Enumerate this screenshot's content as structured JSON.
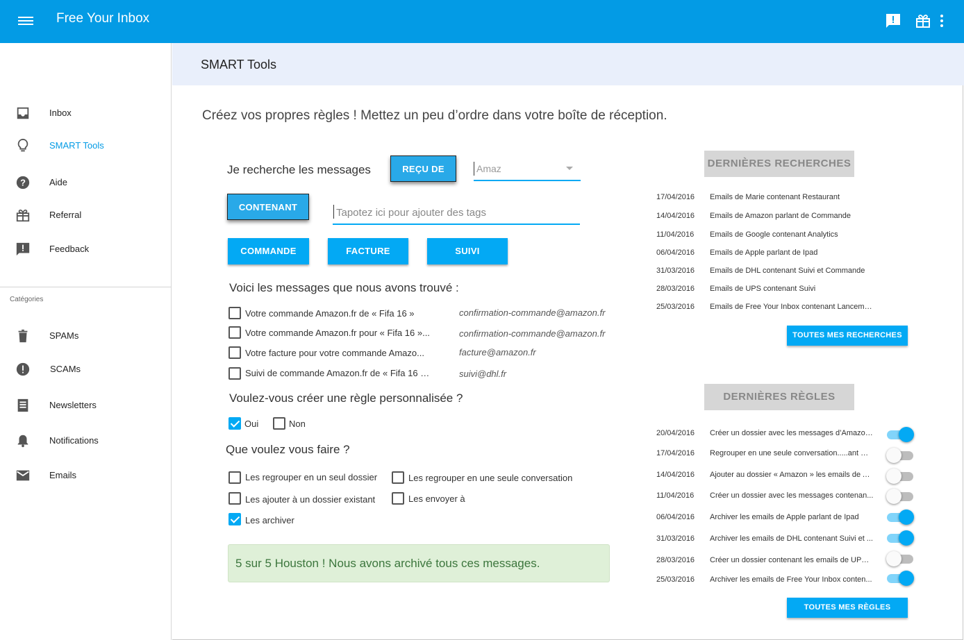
{
  "app": {
    "title": "Free Your Inbox"
  },
  "header": {
    "title": "SMART Tools"
  },
  "sidebar": {
    "items": [
      {
        "label": "Inbox",
        "icon": "inbox-icon"
      },
      {
        "label": "SMART Tools",
        "icon": "lightbulb-icon",
        "active": true
      },
      {
        "label": "Aide",
        "icon": "help-icon"
      },
      {
        "label": "Referral",
        "icon": "gift-icon"
      },
      {
        "label": "Feedback",
        "icon": "feedback-icon"
      }
    ],
    "categories_heading": "Catégories",
    "categories": [
      {
        "label": "SPAMs",
        "icon": "trash-icon"
      },
      {
        "label": "SCAMs",
        "icon": "alert-icon"
      },
      {
        "label": "Newsletters",
        "icon": "newsletter-icon"
      },
      {
        "label": "Notifications",
        "icon": "bell-icon"
      },
      {
        "label": "Emails",
        "icon": "mail-icon"
      }
    ]
  },
  "main": {
    "intro": "Créez vos propres règles ! Mettez un peu d’ordre dans votre boîte de réception.",
    "search_label": "Je recherche les messages",
    "btn_recu": "REÇU DE",
    "select_value": "Amaz",
    "btn_contenant": "CONTENANT",
    "tag_placeholder": "Tapotez ici pour ajouter des tags",
    "tags": [
      "COMMANDE",
      "FACTURE",
      "SUIVI"
    ],
    "found_heading": "Voici les messages que nous avons trouvé :",
    "found": [
      {
        "subject": "Votre commande Amazon.fr de « Fifa 16 »",
        "from": "confirmation-commande@amazon.fr"
      },
      {
        "subject": "Votre commande Amazon.fr pour « Fifa 16 »...",
        "from": "confirmation-commande@amazon.fr"
      },
      {
        "subject": "Votre  facture pour votre commande Amazo...",
        "from": "facture@amazon.fr"
      },
      {
        "subject": "Suivi de commande Amazon.fr de « Fifa 16 »...",
        "from": "suivi@dhl.fr"
      }
    ],
    "rule_question": "Voulez-vous créer une règle personnalisée ?",
    "yes": "Oui",
    "no": "Non",
    "action_question": "Que voulez vous faire ?",
    "actions": {
      "a1": "Les regrouper en un seul dossier",
      "a2": "Les regrouper en une seule conversation",
      "a3": "Les ajouter à un dossier existant",
      "a4": "Les envoyer à",
      "a5": "Les archiver"
    },
    "success": "5 sur 5 Houston ! Nous avons archivé tous ces messages."
  },
  "recent_searches": {
    "heading": "DERNIÈRES RECHERCHES",
    "rows": [
      {
        "date": "17/04/2016",
        "text": "Emails de Marie contenant Restaurant"
      },
      {
        "date": "14/04/2016",
        "text": "Emails de Amazon parlant de Commande"
      },
      {
        "date": "11/04/2016",
        "text": "Emails de Google contenant Analytics"
      },
      {
        "date": "06/04/2016",
        "text": "Emails de Apple parlant de Ipad"
      },
      {
        "date": "31/03/2016",
        "text": "Emails de DHL contenant Suivi et Commande"
      },
      {
        "date": "28/03/2016",
        "text": "Emails de UPS contenant Suivi"
      },
      {
        "date": "25/03/2016",
        "text": "Emails de Free Your Inbox contenant Lancement"
      }
    ],
    "button": "TOUTES MES RECHERCHES"
  },
  "recent_rules": {
    "heading": "DERNIÈRES RÈGLES",
    "rows": [
      {
        "date": "20/04/2016",
        "text": "Créer un dossier avec les messages d’Amazon...",
        "on": true
      },
      {
        "date": "17/04/2016",
        "text": " Regrouper en une seule conversation.....ant Re...",
        "on": false
      },
      {
        "date": "14/04/2016",
        "text": " Ajouter au dossier « Amazon » les emails de A ...",
        "on": false
      },
      {
        "date": "11/04/2016",
        "text": "Créer un dossier avec les messages contenan...",
        "on": false
      },
      {
        "date": "06/04/2016",
        "text": " Archiver les emails de Apple parlant de Ipad",
        "on": true
      },
      {
        "date": "31/03/2016",
        "text": "Archiver les emails de DHL contenant Suivi et ...",
        "on": true
      },
      {
        "date": "28/03/2016",
        "text": "Créer un dossier contenant les emails de UPS ...",
        "on": false
      },
      {
        "date": "25/03/2016",
        "text": " Archiver les emails de Free Your Inbox conten...",
        "on": true
      }
    ],
    "button": "TOUTES MES RÈGLES"
  },
  "colors": {
    "primary": "#039be5",
    "accent": "#03a9f4",
    "success_bg": "#dff0d8",
    "success_text": "#3c763d"
  }
}
